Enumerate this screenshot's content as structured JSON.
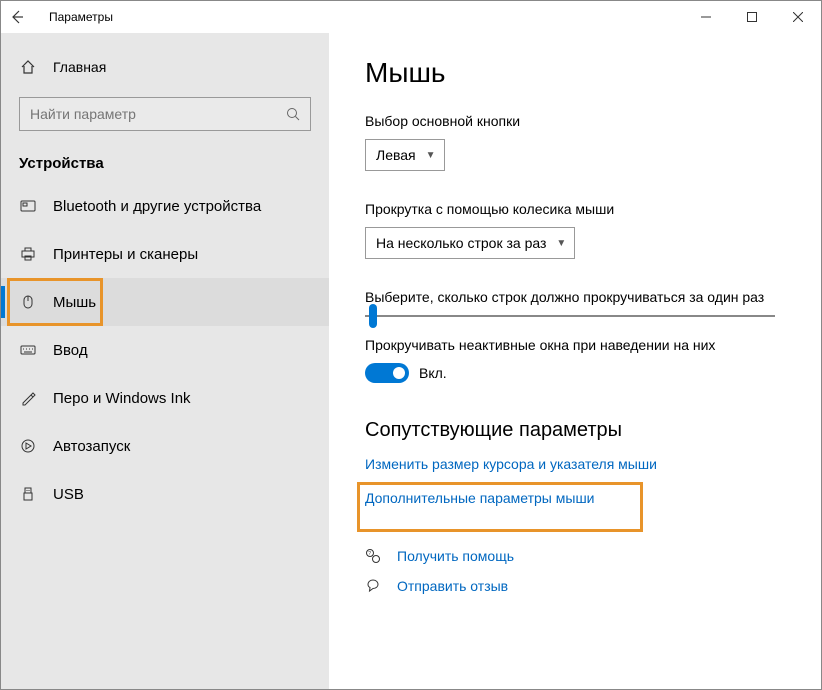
{
  "window_title": "Параметры",
  "home_label": "Главная",
  "search_placeholder": "Найти параметр",
  "category_label": "Устройства",
  "nav": [
    {
      "label": "Bluetooth и другие устройства",
      "icon": "bluetooth",
      "active": false
    },
    {
      "label": "Принтеры и сканеры",
      "icon": "printer",
      "active": false
    },
    {
      "label": "Мышь",
      "icon": "mouse",
      "active": true,
      "highlight": true
    },
    {
      "label": "Ввод",
      "icon": "keyboard",
      "active": false
    },
    {
      "label": "Перо и Windows Ink",
      "icon": "pen",
      "active": false
    },
    {
      "label": "Автозапуск",
      "icon": "autoplay",
      "active": false
    },
    {
      "label": "USB",
      "icon": "usb",
      "active": false
    }
  ],
  "page_title": "Мышь",
  "primary_button_label": "Выбор основной кнопки",
  "primary_button_value": "Левая",
  "scroll_wheel_label": "Прокрутка с помощью колесика мыши",
  "scroll_wheel_value": "На несколько строк за раз",
  "lines_label": "Выберите, сколько строк должно прокручиваться за один раз",
  "inactive_scroll_label": "Прокручивать неактивные окна при наведении на них",
  "inactive_scroll_state": "Вкл.",
  "related_title": "Сопутствующие параметры",
  "link_cursor_size": "Изменить размер курсора и указателя мыши",
  "link_additional": "Дополнительные параметры мыши",
  "link_help": "Получить помощь",
  "link_feedback": "Отправить отзыв"
}
